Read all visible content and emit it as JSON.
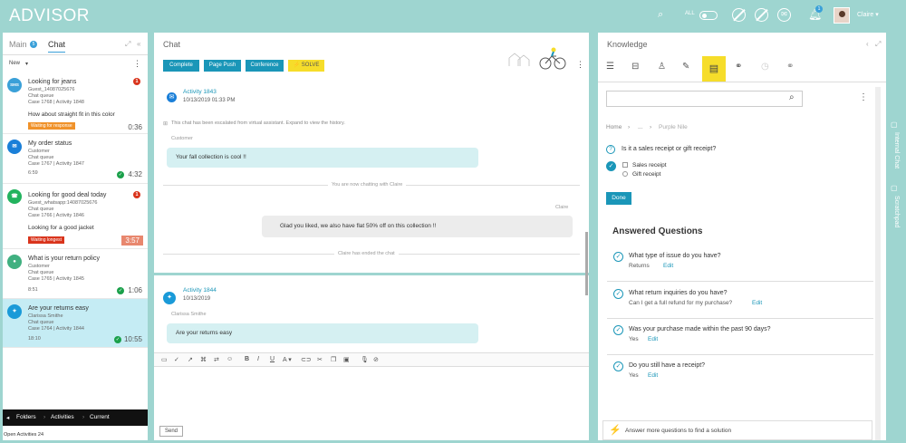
{
  "app": {
    "title": "ADVISOR"
  },
  "topbar": {
    "all_label": "ALL",
    "notif_count": "1",
    "user_name": "Claire ▾"
  },
  "left": {
    "tab_main": "Main",
    "main_count": "5",
    "tab_chat": "Chat",
    "filter": "New",
    "items": [
      {
        "channel_icon": "sms-icon",
        "channel_text": "SMS",
        "channel_color": "#3aa0d8",
        "title": "Looking for jeans",
        "line1": "Guest_14087025676",
        "line2": "Chat queue",
        "line3": "Case 1768   |   Activity 1848",
        "message": "How about straight fit in this color",
        "tag": "Waiting for response",
        "tag_color": "#f0922a",
        "time": "0:36",
        "badge": "1"
      },
      {
        "channel_icon": "messenger-icon",
        "channel_text": "✉",
        "channel_color": "#1a7fd8",
        "title": "My order status",
        "line1": "Customer",
        "line2": "Chat queue",
        "line3": "Case 1767   |   Activity 1847",
        "line4": "6:59",
        "time": "4:32"
      },
      {
        "channel_icon": "whatsapp-icon",
        "channel_text": "☎",
        "channel_color": "#22b35e",
        "title": "Looking for good deal today",
        "line1": "Guest_whatsapp:14087025676",
        "line2": "Chat queue",
        "line3": "Case 1766   |   Activity 1846",
        "message": "Looking for a good jacket",
        "tag": "Waiting longest",
        "tag_color": "#d9341c",
        "time": "3:57",
        "badge": "1"
      },
      {
        "channel_icon": "apple-icon",
        "channel_text": "●",
        "channel_color": "#40b080",
        "title": "What is your return policy",
        "line1": "Customer",
        "line2": "Chat queue",
        "line3": "Case 1765   |   Activity 1845",
        "line4": "8:51",
        "time": "1:06"
      },
      {
        "channel_icon": "twitter-icon",
        "channel_text": "✦",
        "channel_color": "#1a9ad8",
        "title": "Are your returns easy",
        "line1": "Clarissa Smithe",
        "line2": "Chat queue",
        "line3": "Case 1764   |   Activity 1844",
        "line4": "18:10",
        "time": "10:55"
      }
    ],
    "footer": {
      "folders": "Folders",
      "activities": "Activities",
      "current": "Current"
    },
    "open_activities": "Open Activities 24"
  },
  "chat": {
    "header": "Chat",
    "buttons": {
      "complete": "Complete",
      "page_push": "Page Push",
      "conference": "Conference",
      "solve": "SOLVE"
    },
    "upper": {
      "activity": "Activity 1843",
      "timestamp": "10/13/2019 01:33 PM",
      "escalation": "This chat has been escalated from virtual assistant. Expand to view the history.",
      "customer_label": "Customer",
      "customer_msg": "Your fall collection is cool !!",
      "now_chatting": "You are now chatting with Claire",
      "agent_label": "Claire",
      "agent_msg": "Glad you liked, we also have flat 50% off on this collection !!",
      "ended": "Claire has ended the chat"
    },
    "lower": {
      "activity": "Activity 1844",
      "timestamp": "10/13/2019",
      "customer_label": "Clarissa Smithe",
      "customer_msg": "Are your returns easy"
    },
    "send": "Send"
  },
  "knowledge": {
    "header": "Knowledge",
    "breadcrumb_home": "Home",
    "breadcrumb_mid": "...",
    "breadcrumb_current": "Purple Nile",
    "question": "Is it a sales receipt or gift receipt?",
    "options": [
      "Sales receipt",
      "Gift receipt"
    ],
    "done": "Done",
    "answered_title": "Answered Questions",
    "answered": [
      {
        "q": "What type of issue do you have?",
        "a": "Returns",
        "edit": "Edit"
      },
      {
        "q": "What return inquiries do you have?",
        "a": "Can I get a full refund for my purchase?",
        "edit": "Edit"
      },
      {
        "q": "Was your purchase made within the past 90 days?",
        "a": "Yes",
        "edit": "Edit"
      },
      {
        "q": "Do you still have a receipt?",
        "a": "Yes",
        "edit": "Edit"
      }
    ],
    "footer": "Answer more questions to find a solution"
  },
  "sidebar": {
    "internal_chat": "Internal Chat",
    "scratchpad": "Scratchpad"
  }
}
